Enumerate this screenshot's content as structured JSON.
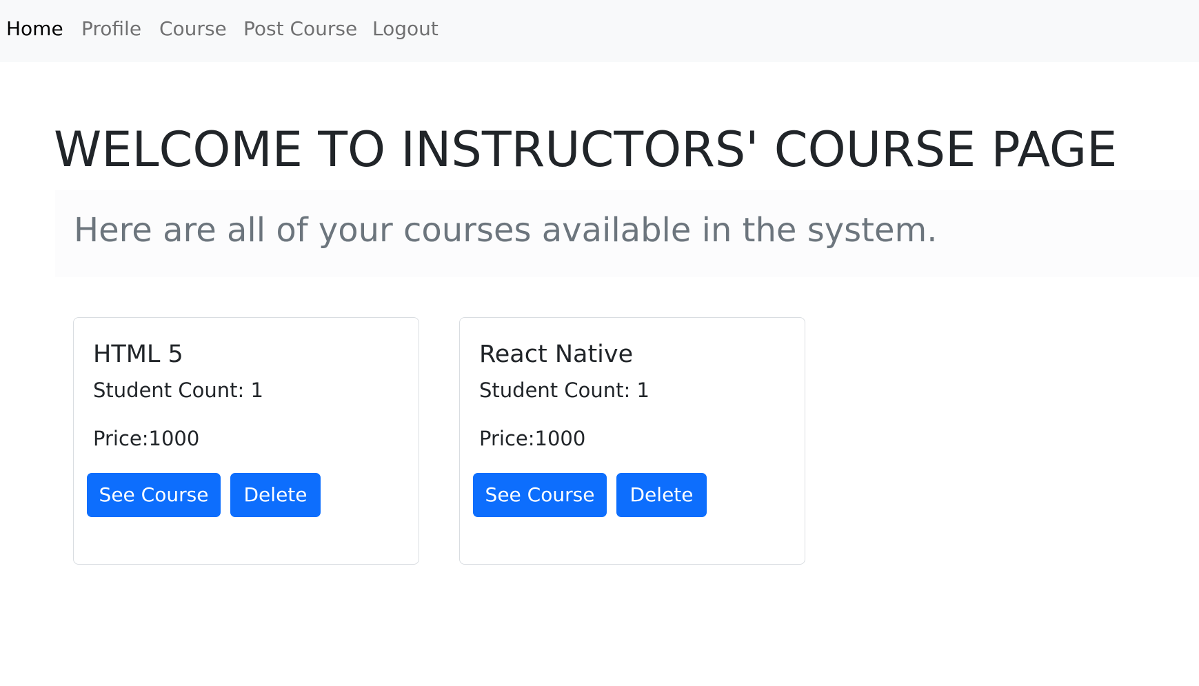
{
  "nav": {
    "items": [
      {
        "label": "Home",
        "active": true
      },
      {
        "label": "Profile",
        "active": false
      },
      {
        "label": "Course",
        "active": false
      },
      {
        "label": "Post Course",
        "active": false
      },
      {
        "label": "Logout",
        "active": false
      }
    ]
  },
  "main": {
    "title": "WELCOME TO INSTRUCTORS' COURSE PAGE",
    "lead": "Here are all of your courses available in the system."
  },
  "courses": [
    {
      "name": "HTML 5",
      "student_count": "Student Count: 1",
      "price": "Price:1000",
      "see_label": "See Course",
      "delete_label": "Delete"
    },
    {
      "name": "React Native",
      "student_count": "Student Count: 1",
      "price": "Price:1000",
      "see_label": "See Course",
      "delete_label": "Delete"
    }
  ],
  "colors": {
    "primary": "#0d6efd",
    "navbar_bg": "#f8f9fa",
    "muted_text": "#6c757d"
  }
}
